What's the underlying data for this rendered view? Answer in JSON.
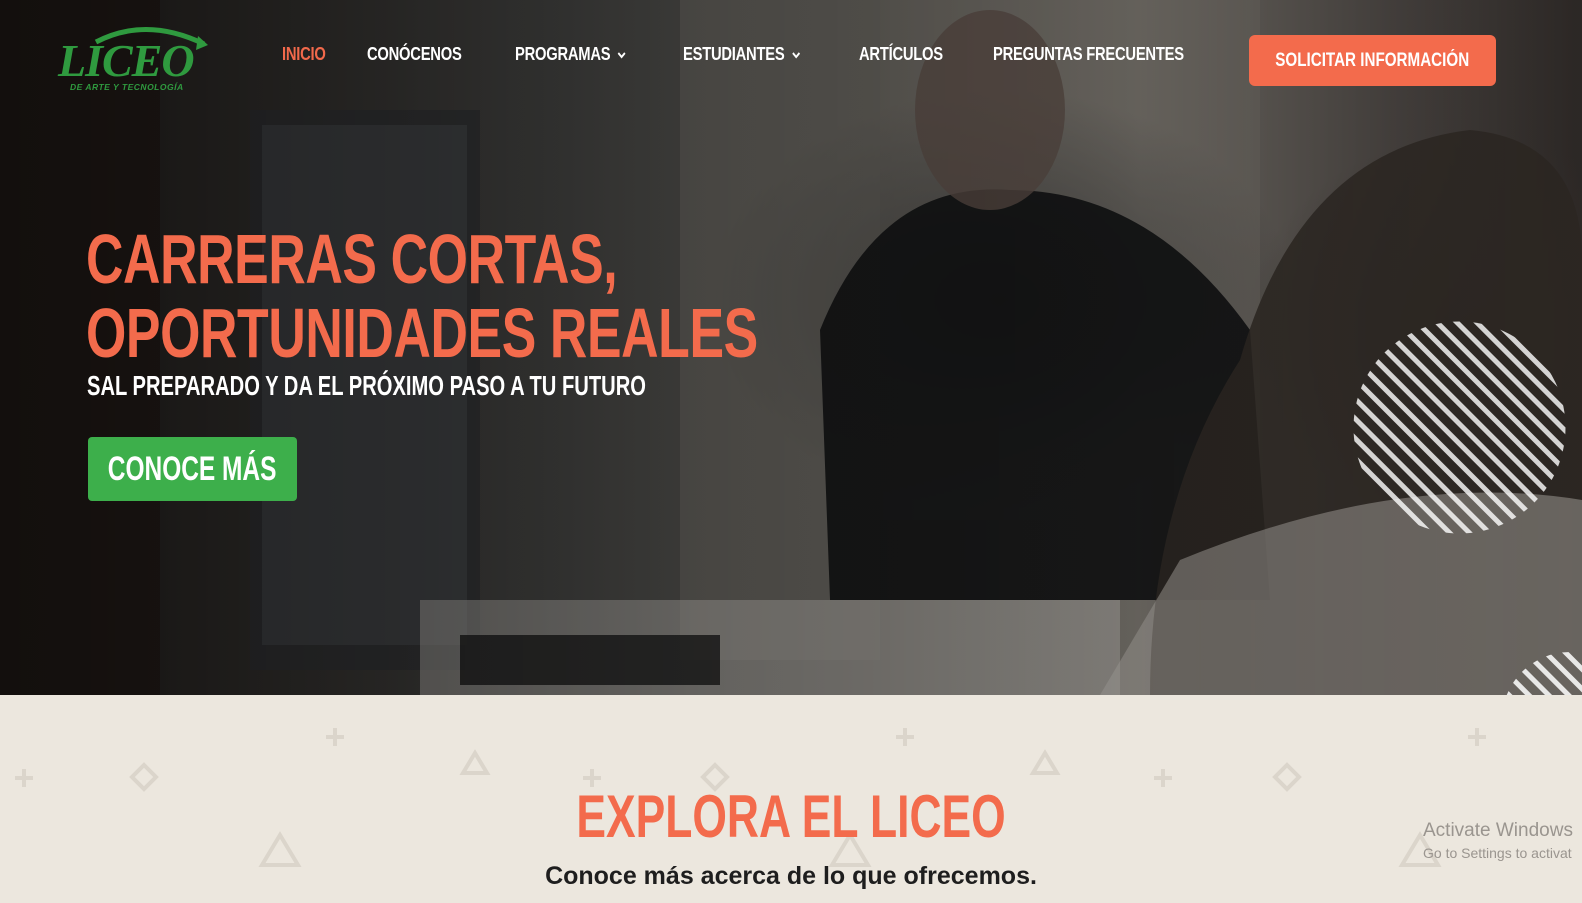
{
  "brand": {
    "logo_text": "LICEO",
    "logo_tagline": "DE ARTE Y TECNOLOGÍA",
    "accent_color": "#f36b4c",
    "green_color": "#3daf4b"
  },
  "nav": {
    "items": [
      {
        "label": "INICIO",
        "active": true,
        "has_dropdown": false
      },
      {
        "label": "CONÓCENOS",
        "active": false,
        "has_dropdown": false
      },
      {
        "label": "PROGRAMAS",
        "active": false,
        "has_dropdown": true
      },
      {
        "label": "ESTUDIANTES",
        "active": false,
        "has_dropdown": true
      },
      {
        "label": "ARTÍCULOS",
        "active": false,
        "has_dropdown": false
      },
      {
        "label": "PREGUNTAS FRECUENTES",
        "active": false,
        "has_dropdown": false
      }
    ],
    "cta_label": "SOLICITAR INFORMACIÓN"
  },
  "hero": {
    "title_line1": "CARRERAS CORTAS,",
    "title_line2": "OPORTUNIDADES REALES",
    "subtitle": "SAL PREPARADO Y DA EL PRÓXIMO PASO A TU FUTURO",
    "button_label": "CONOCE MÁS"
  },
  "explore": {
    "title": "EXPLORA EL LICEO",
    "subtitle": "Conoce más acerca de lo que ofrecemos."
  },
  "os_watermark": {
    "line1": "Activate Windows",
    "line2": "Go to Settings to activat"
  }
}
